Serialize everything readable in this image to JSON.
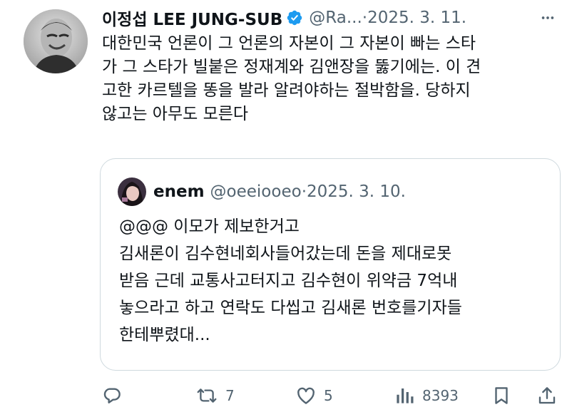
{
  "tweet": {
    "author_name": "이정섭 LEE JUNG-SUB",
    "handle": "@Ra...",
    "separator": "·",
    "date": "2025. 3. 11.",
    "text": "대한민국 언론이 그 언론의 자본이 그 자본이 빠는 스타\n가 그 스타가 빌붙은 정재계와 김앤장을 뚫기에는. 이 견\n고한 카르텔을 똥을 발라 알려야하는 절박함을. 당하지\n않고는 아무도 모른다"
  },
  "quoted_tweet": {
    "author_name": "enem",
    "handle": "@oeeiooeo",
    "separator": "·",
    "date": "2025. 3. 10.",
    "text": "@@@ 이모가 제보한거고\n김새론이 김수현네회사들어갔는데 돈을 제대로못\n받음 근데 교통사고터지고 김수현이 위약금 7억내\n놓으라고 하고 연락도 다씹고 김새론 번호를기자들\n한테뿌렸대..."
  },
  "actions": {
    "reply_count": "",
    "retweet_count": "7",
    "like_count": "5",
    "view_count": "8393"
  },
  "icons": {
    "verified": "verified-badge-icon",
    "more": "more-icon",
    "reply": "reply-icon",
    "retweet": "retweet-icon",
    "like": "heart-icon",
    "views": "views-icon",
    "bookmark": "bookmark-icon",
    "share": "share-icon"
  },
  "colors": {
    "text": "#0f1419",
    "secondary": "#536471",
    "verified": "#1d9bf0",
    "border": "#cfd9de"
  }
}
